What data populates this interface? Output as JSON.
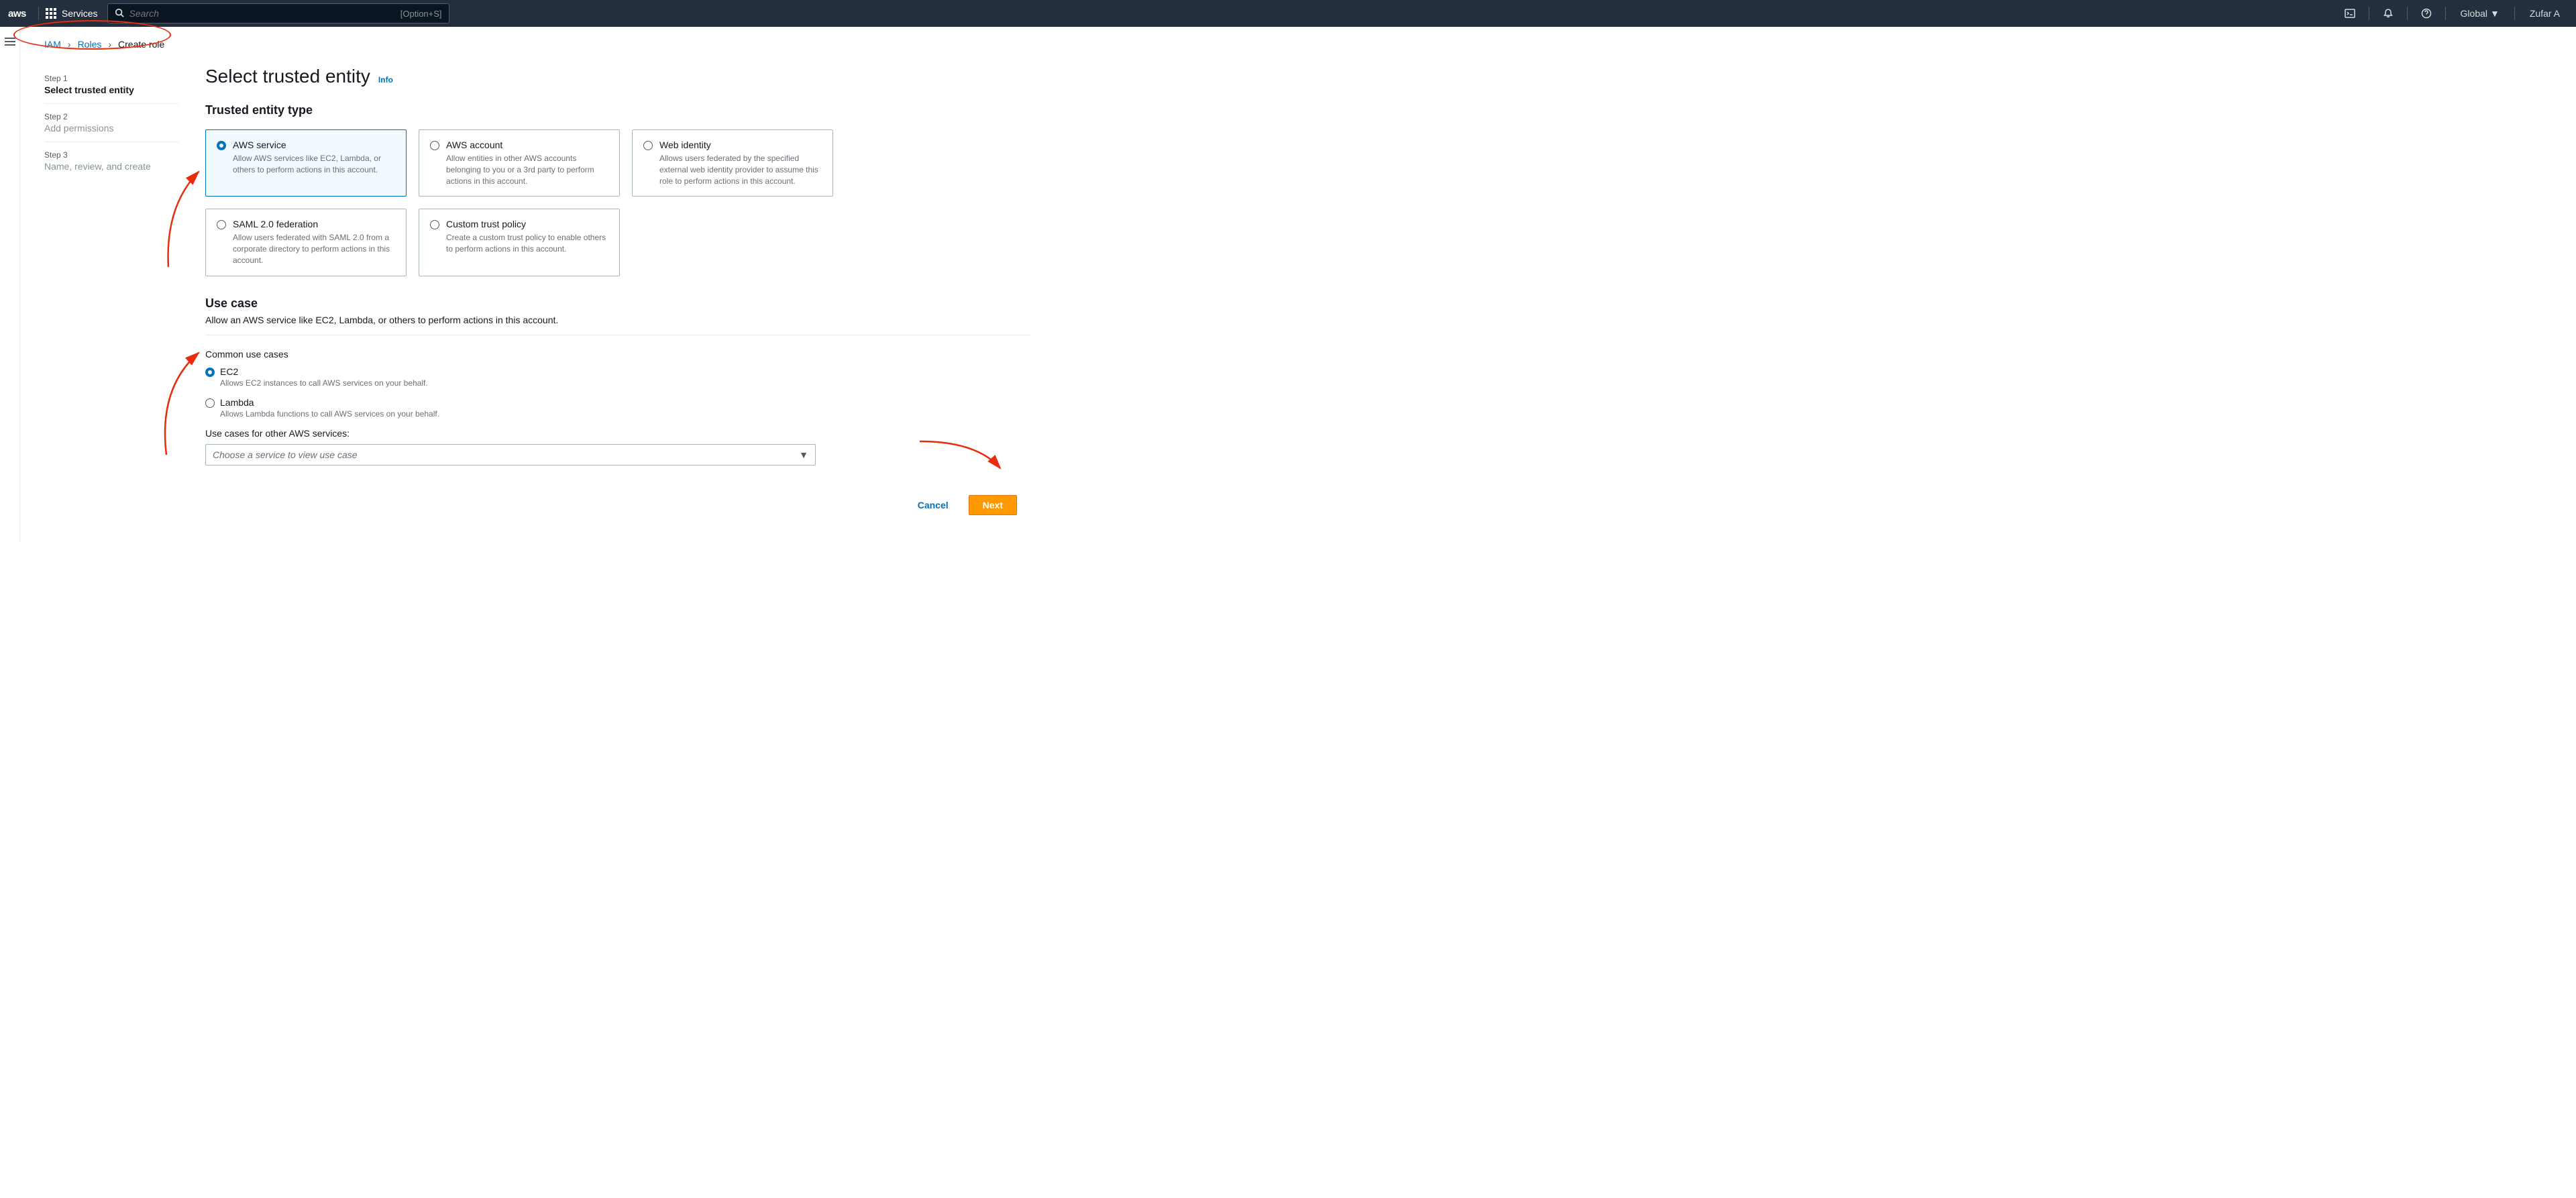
{
  "topnav": {
    "logo": "aws",
    "services_label": "Services",
    "search_placeholder": "Search",
    "search_shortcut": "[Option+S]",
    "region": "Global",
    "user": "Zufar A"
  },
  "breadcrumb": {
    "items": [
      "IAM",
      "Roles",
      "Create role"
    ]
  },
  "steps": [
    {
      "num": "Step 1",
      "title": "Select trusted entity",
      "active": true
    },
    {
      "num": "Step 2",
      "title": "Add permissions",
      "active": false
    },
    {
      "num": "Step 3",
      "title": "Name, review, and create",
      "active": false
    }
  ],
  "heading": "Select trusted entity",
  "info_label": "Info",
  "entity_section_title": "Trusted entity type",
  "tiles": [
    {
      "title": "AWS service",
      "desc": "Allow AWS services like EC2, Lambda, or others to perform actions in this account.",
      "selected": true
    },
    {
      "title": "AWS account",
      "desc": "Allow entities in other AWS accounts belonging to you or a 3rd party to perform actions in this account.",
      "selected": false
    },
    {
      "title": "Web identity",
      "desc": "Allows users federated by the specified external web identity provider to assume this role to perform actions in this account.",
      "selected": false
    },
    {
      "title": "SAML 2.0 federation",
      "desc": "Allow users federated with SAML 2.0 from a corporate directory to perform actions in this account.",
      "selected": false
    },
    {
      "title": "Custom trust policy",
      "desc": "Create a custom trust policy to enable others to perform actions in this account.",
      "selected": false
    }
  ],
  "usecase": {
    "heading": "Use case",
    "sub": "Allow an AWS service like EC2, Lambda, or others to perform actions in this account.",
    "common_label": "Common use cases",
    "options": [
      {
        "title": "EC2",
        "desc": "Allows EC2 instances to call AWS services on your behalf.",
        "selected": true
      },
      {
        "title": "Lambda",
        "desc": "Allows Lambda functions to call AWS services on your behalf.",
        "selected": false
      }
    ],
    "other_label": "Use cases for other AWS services:",
    "select_placeholder": "Choose a service to view use case"
  },
  "footer": {
    "cancel": "Cancel",
    "next": "Next"
  }
}
